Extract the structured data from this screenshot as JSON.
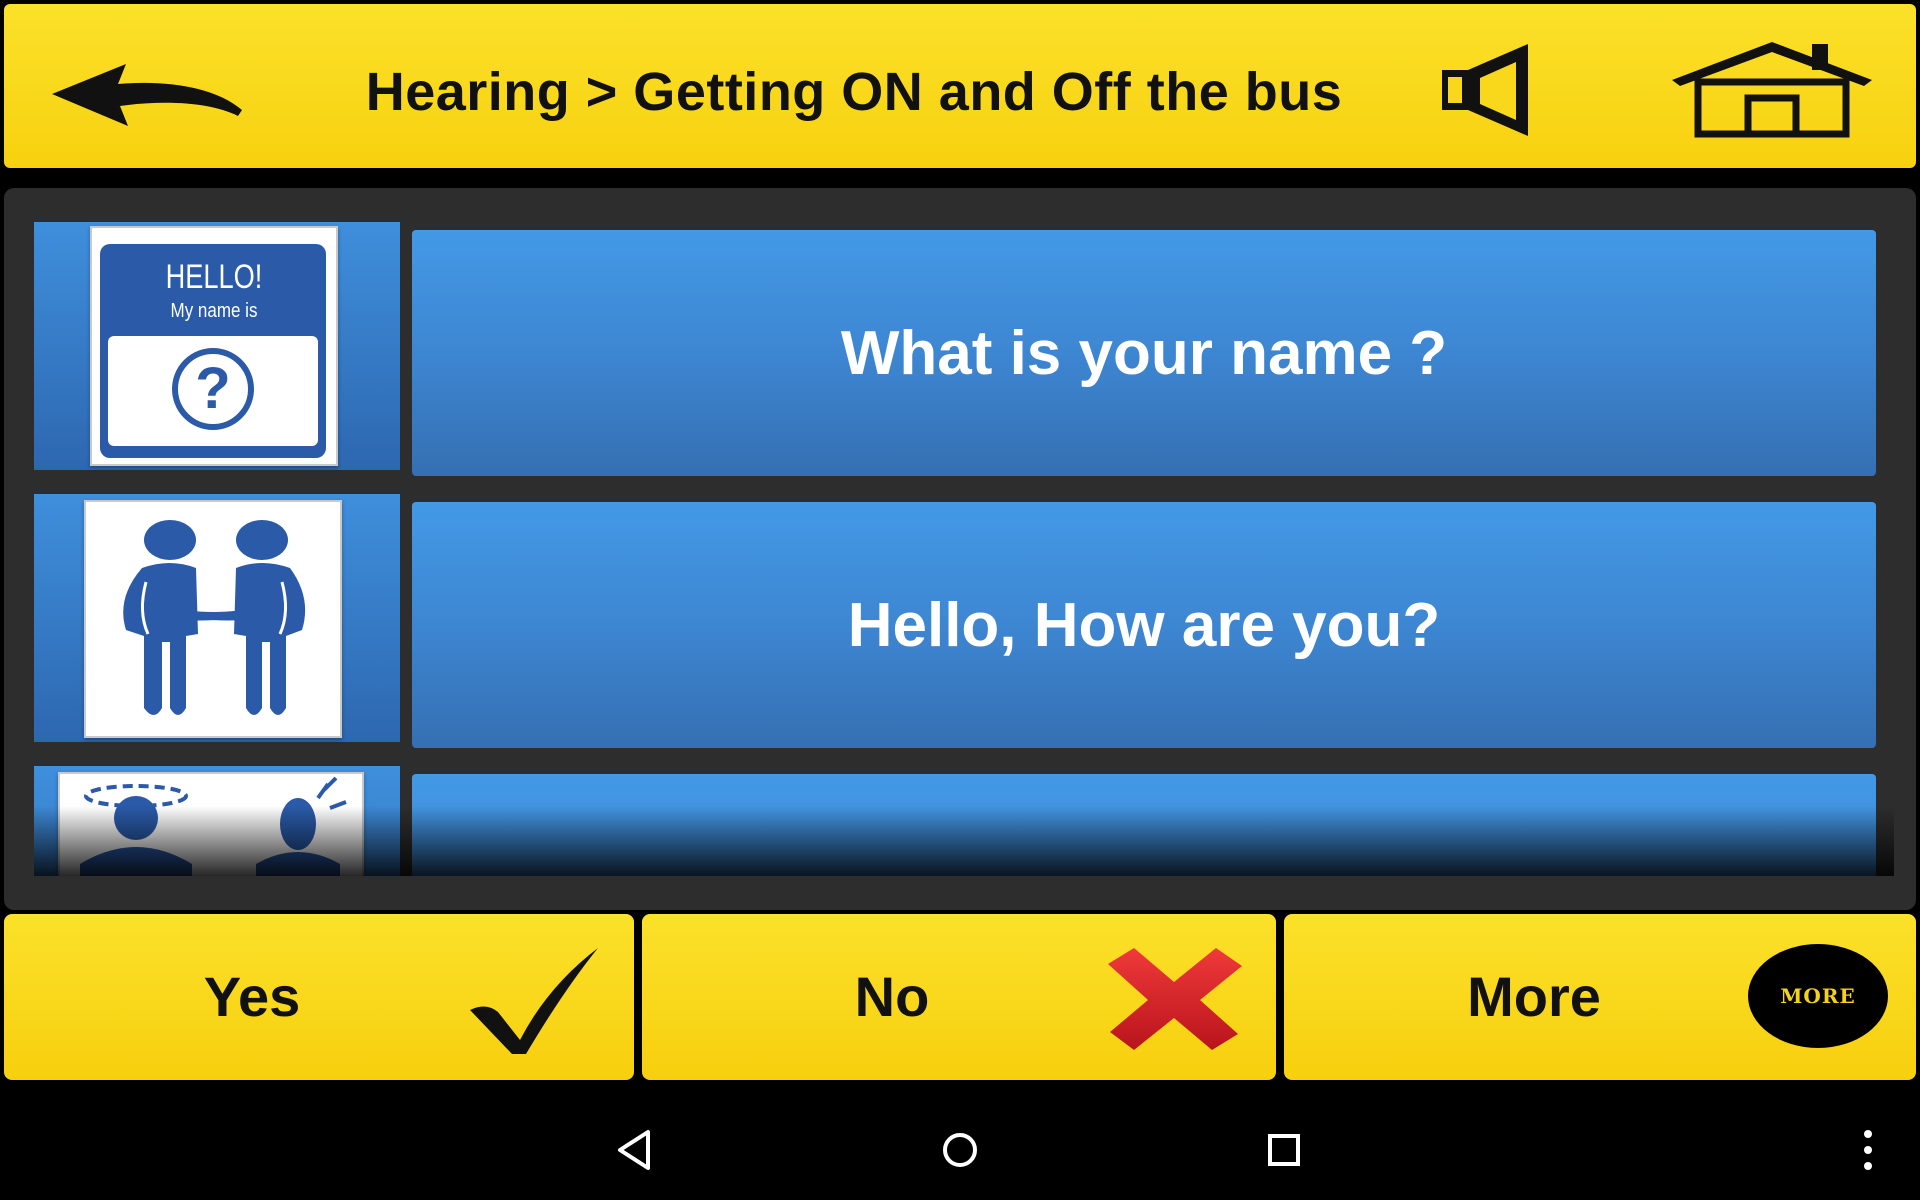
{
  "header": {
    "title": "Hearing > Getting ON and Off the bus",
    "back_icon": "back-arrow-icon",
    "speaker_icon": "speaker-icon",
    "home_icon": "home-icon"
  },
  "list": {
    "items": [
      {
        "label": "What is your name ?",
        "icon": "name-tag-icon",
        "badge_title": "HELLO!",
        "badge_subtitle": "My name is",
        "badge_symbol": "?"
      },
      {
        "label": "Hello, How are you?",
        "icon": "handshake-icon"
      },
      {
        "label": "",
        "icon": "dizzy-person-icon"
      }
    ]
  },
  "buttons": {
    "yes": {
      "label": "Yes",
      "icon": "checkmark-icon"
    },
    "no": {
      "label": "No",
      "icon": "red-x-icon"
    },
    "more": {
      "label": "More",
      "icon_text": "MORE"
    }
  },
  "navbar": {
    "items": [
      "back-triangle-icon",
      "home-circle-icon",
      "recents-square-icon",
      "overflow-menu-icon"
    ]
  },
  "colors": {
    "header_yellow": "#f9d81c",
    "row_blue": "#3d86d2",
    "badge_blue": "#2a5aa8",
    "x_red": "#d8202a"
  }
}
